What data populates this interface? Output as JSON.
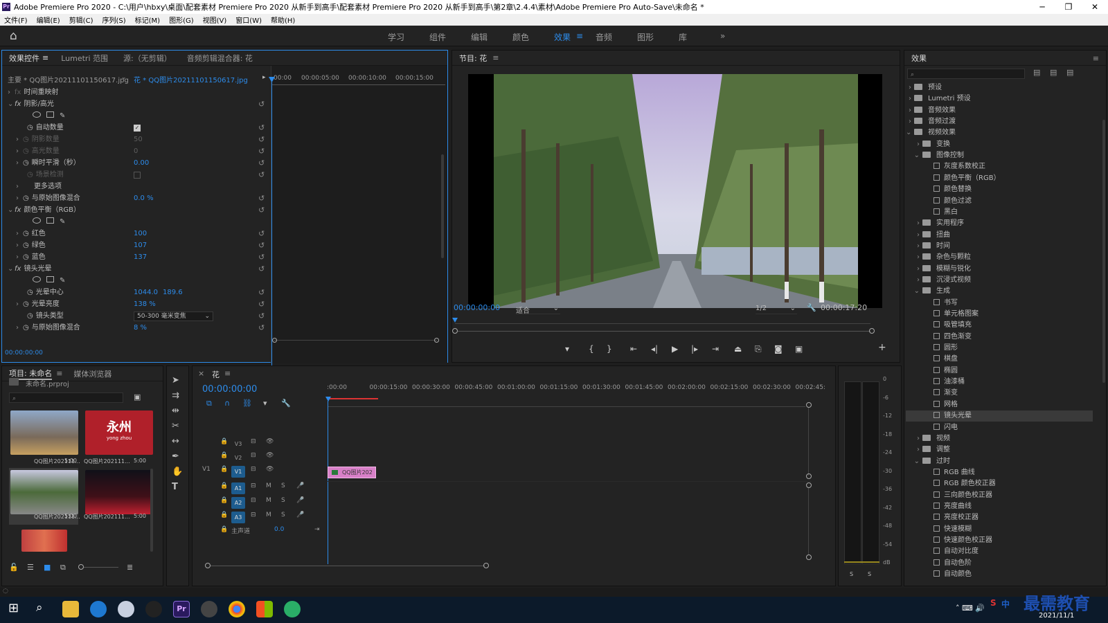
{
  "title": "Adobe Premiere Pro 2020 - C:\\用户\\hbxy\\桌面\\配套素材 Premiere Pro 2020 从新手到高手\\配套素材 Premiere Pro 2020 从新手到高手\\第2章\\2.4.4\\素材\\Adobe Premiere Pro Auto-Save\\未命名 *",
  "window_controls": {
    "minimize": "─",
    "restore": "❐",
    "close": "✕"
  },
  "menu": [
    "文件(F)",
    "编辑(E)",
    "剪辑(C)",
    "序列(S)",
    "标记(M)",
    "图形(G)",
    "视图(V)",
    "窗口(W)",
    "帮助(H)"
  ],
  "workspaces": [
    "学习",
    "组件",
    "编辑",
    "颜色",
    "效果",
    "音频",
    "图形",
    "库"
  ],
  "workspace_active": "效果",
  "workspace_more": "»",
  "effect_controls": {
    "tabs": [
      "效果控件",
      "Lumetri 范围",
      "源:（无剪辑）",
      "音频剪辑混合器: 花"
    ],
    "master": "主要 * QQ图片20211101150617.jpg",
    "clip": "花 * QQ图片20211101150617.jpg",
    "ruler": [
      "00:00",
      "00:00:05:00",
      "00:00:10:00",
      "00:00:15:00"
    ],
    "rows": {
      "time_remap": "时间重映射",
      "shadow_highlight": "阴影/高光",
      "auto_amount": "自动数量",
      "shadow_amount": "阴影数量",
      "shadow_val": "50",
      "highlight_amount": "高光数量",
      "highlight_val": "0",
      "temporal_smooth": "瞬时平滑（秒）",
      "temporal_val": "0.00",
      "scene_detect": "场景检测",
      "more_options": "更多选项",
      "blend1": "与原始图像混合",
      "blend1_val": "0.0 %",
      "color_balance": "颜色平衡（RGB）",
      "red": "红色",
      "red_val": "100",
      "green": "绿色",
      "green_val": "107",
      "blue": "蓝色",
      "blue_val": "137",
      "lens_flare": "镜头光晕",
      "flare_center": "光晕中心",
      "flare_x": "1044.0",
      "flare_y": "189.6",
      "flare_brightness": "光晕亮度",
      "flare_brightness_val": "138 %",
      "lens_type": "镜头类型",
      "lens_type_val": "50-300 毫米变焦",
      "blend2": "与原始图像混合",
      "blend2_val": "8 %"
    },
    "timecode": "00:00:00:00"
  },
  "program": {
    "title": "节目: 花",
    "timecode": "00:00:00:00",
    "fit": "适合",
    "resolution": "1/2",
    "duration": "00:00:17:20"
  },
  "effects": {
    "title": "效果",
    "tree": [
      {
        "label": "预设",
        "level": 0,
        "open": false,
        "type": "folder"
      },
      {
        "label": "Lumetri 预设",
        "level": 0,
        "open": false,
        "type": "folder"
      },
      {
        "label": "音频效果",
        "level": 0,
        "open": false,
        "type": "folder"
      },
      {
        "label": "音频过渡",
        "level": 0,
        "open": false,
        "type": "folder"
      },
      {
        "label": "视频效果",
        "level": 0,
        "open": true,
        "type": "folder"
      },
      {
        "label": "变换",
        "level": 1,
        "open": false,
        "type": "folder"
      },
      {
        "label": "图像控制",
        "level": 1,
        "open": true,
        "type": "folder"
      },
      {
        "label": "灰度系数校正",
        "level": 2,
        "type": "fx"
      },
      {
        "label": "颜色平衡（RGB）",
        "level": 2,
        "type": "fx"
      },
      {
        "label": "颜色替换",
        "level": 2,
        "type": "fx"
      },
      {
        "label": "颜色过滤",
        "level": 2,
        "type": "fx"
      },
      {
        "label": "黑白",
        "level": 2,
        "type": "fx"
      },
      {
        "label": "实用程序",
        "level": 1,
        "open": false,
        "type": "folder"
      },
      {
        "label": "扭曲",
        "level": 1,
        "open": false,
        "type": "folder"
      },
      {
        "label": "时间",
        "level": 1,
        "open": false,
        "type": "folder"
      },
      {
        "label": "杂色与颗粒",
        "level": 1,
        "open": false,
        "type": "folder"
      },
      {
        "label": "模糊与锐化",
        "level": 1,
        "open": false,
        "type": "folder"
      },
      {
        "label": "沉浸式视频",
        "level": 1,
        "open": false,
        "type": "folder"
      },
      {
        "label": "生成",
        "level": 1,
        "open": true,
        "type": "folder"
      },
      {
        "label": "书写",
        "level": 2,
        "type": "fx"
      },
      {
        "label": "单元格图案",
        "level": 2,
        "type": "fx"
      },
      {
        "label": "吸管填充",
        "level": 2,
        "type": "fx"
      },
      {
        "label": "四色渐变",
        "level": 2,
        "type": "fx"
      },
      {
        "label": "圆形",
        "level": 2,
        "type": "fx"
      },
      {
        "label": "棋盘",
        "level": 2,
        "type": "fx"
      },
      {
        "label": "椭圆",
        "level": 2,
        "type": "fx"
      },
      {
        "label": "油漆桶",
        "level": 2,
        "type": "fx"
      },
      {
        "label": "渐变",
        "level": 2,
        "type": "fx"
      },
      {
        "label": "网格",
        "level": 2,
        "type": "fx"
      },
      {
        "label": "镜头光晕",
        "level": 2,
        "type": "fx",
        "selected": true
      },
      {
        "label": "闪电",
        "level": 2,
        "type": "fx"
      },
      {
        "label": "视频",
        "level": 1,
        "open": false,
        "type": "folder"
      },
      {
        "label": "调整",
        "level": 1,
        "open": false,
        "type": "folder"
      },
      {
        "label": "过时",
        "level": 1,
        "open": true,
        "type": "folder"
      },
      {
        "label": "RGB 曲线",
        "level": 2,
        "type": "fx"
      },
      {
        "label": "RGB 颜色校正器",
        "level": 2,
        "type": "fx"
      },
      {
        "label": "三向颜色校正器",
        "level": 2,
        "type": "fx"
      },
      {
        "label": "亮度曲线",
        "level": 2,
        "type": "fx"
      },
      {
        "label": "亮度校正器",
        "level": 2,
        "type": "fx"
      },
      {
        "label": "快速模糊",
        "level": 2,
        "type": "fx"
      },
      {
        "label": "快速颜色校正器",
        "level": 2,
        "type": "fx"
      },
      {
        "label": "自动对比度",
        "level": 2,
        "type": "fx"
      },
      {
        "label": "自动色阶",
        "level": 2,
        "type": "fx"
      },
      {
        "label": "自动颜色",
        "level": 2,
        "type": "fx"
      }
    ]
  },
  "project": {
    "tabs": [
      "项目: 未命名",
      "媒体浏览器"
    ],
    "file": "未命名.prproj",
    "items": [
      {
        "name": "QQ图片202111...",
        "duration": "5:00"
      },
      {
        "name": "QQ图片202111...",
        "duration": "5:00"
      },
      {
        "name": "QQ图片202111...",
        "duration": "5:00"
      },
      {
        "name": "QQ图片202111...",
        "duration": "5:00"
      }
    ],
    "thumb2_text": "永州",
    "thumb2_sub": "yong zhou"
  },
  "timeline": {
    "tab": "花",
    "timecode": "00:00:00:00",
    "ruler": [
      ":00:00",
      "00:00:15:00",
      "00:00:30:00",
      "00:00:45:00",
      "00:01:00:00",
      "00:01:15:00",
      "00:01:30:00",
      "00:01:45:00",
      "00:02:00:00",
      "00:02:15:00",
      "00:02:30:00",
      "00:02:45:"
    ],
    "video_tracks": [
      "V3",
      "V2",
      "V1"
    ],
    "audio_tracks": [
      "A1",
      "A2",
      "A3"
    ],
    "src_v1": "V1",
    "master": "主声道",
    "master_val": "0.0",
    "clip": "QQ图片202",
    "m": "M",
    "s": "S"
  },
  "meter": {
    "scale": [
      "0",
      "-6",
      "-12",
      "-18",
      "-24",
      "-30",
      "-36",
      "-42",
      "-48",
      "-54",
      "dB"
    ],
    "solo": "S"
  },
  "taskbar": {
    "date": "2021/11/1",
    "watermark": "最需教育",
    "ime": "中"
  },
  "colors": {
    "accent": "#2d8ceb",
    "clip": "#d880c8",
    "playhead": "#2d8ceb",
    "selected": "#3a3a3a"
  }
}
